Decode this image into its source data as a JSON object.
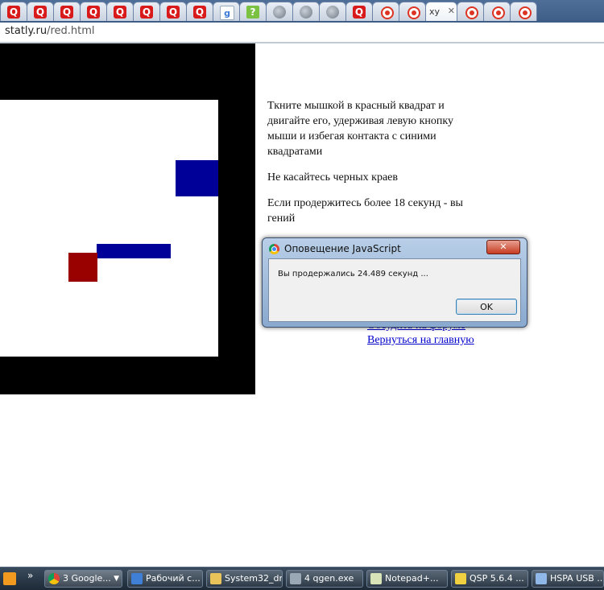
{
  "browser": {
    "tabs": [
      {
        "icon": "q-icon"
      },
      {
        "icon": "q-icon"
      },
      {
        "icon": "q-icon"
      },
      {
        "icon": "q-icon"
      },
      {
        "icon": "q-icon"
      },
      {
        "icon": "q-icon"
      },
      {
        "icon": "q-icon"
      },
      {
        "icon": "q-icon"
      },
      {
        "icon": "google-icon"
      },
      {
        "icon": "question-icon"
      },
      {
        "icon": "globe-icon"
      },
      {
        "icon": "globe-icon"
      },
      {
        "icon": "globe-icon"
      },
      {
        "icon": "q-icon"
      },
      {
        "icon": "c-icon"
      },
      {
        "icon": "c-icon"
      }
    ],
    "active_tab": {
      "title": "xy",
      "close": "✕"
    },
    "tabs_after": [
      {
        "icon": "c-icon"
      },
      {
        "icon": "c-icon"
      },
      {
        "icon": "c-icon"
      }
    ],
    "address": {
      "host": "statly.ru",
      "path": "/red.html"
    }
  },
  "page": {
    "instructions": [
      "Ткните мышкой в красный квадрат и двигайте его, удерживая левую кнопку мыши и избегая контакта с синими квадратами",
      "Не касайтесь черных краев",
      "Если продержитесь более 18 секунд - вы гений"
    ],
    "links": {
      "hidden_link": "Обсудить на форуме",
      "back_link": "Вернуться на главную"
    }
  },
  "colors": {
    "red_square": "#990000",
    "blue_square": "#000099",
    "frame": "#000000"
  },
  "alert": {
    "title": "Оповещение JavaScript",
    "close": "✕",
    "message": "Вы продержались 24.489 секунд ...",
    "ok": "OK"
  },
  "taskbar": {
    "items": [
      {
        "label": "3 Google...",
        "icon": "chrome-icon"
      },
      {
        "label": "Рабочий с...",
        "icon": "desktop-icon"
      },
      {
        "label": "System32_dr",
        "icon": "folder-icon"
      },
      {
        "label": "4 qgen.exe",
        "icon": "book-icon"
      },
      {
        "label": "Notepad+...",
        "icon": "notepad-icon"
      },
      {
        "label": "QSP 5.6.4 ...",
        "icon": "qsp-icon"
      },
      {
        "label": "HSPA USB ...",
        "icon": "modem-icon"
      }
    ],
    "chevron": "»"
  }
}
